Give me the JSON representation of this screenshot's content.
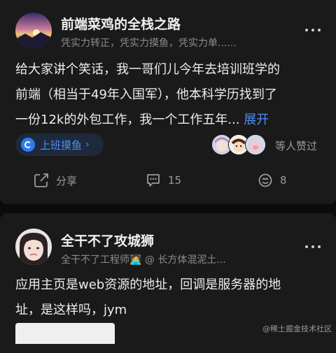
{
  "posts": [
    {
      "author": "前端菜鸡的全栈之路",
      "subtitle": "凭实力转正，凭实力摸鱼，凭实力单......",
      "content_line1": "给大家讲个笑话，我一哥们儿今年去培训班学的",
      "content_line2": "前端（相当于49年入国军），他本科学历找到了",
      "content_line3": "一份12k的外包工作，我一个工作五年...",
      "expand_label": "展开",
      "topic_label": "上班摸鱼",
      "topic_chevron": "›",
      "likes_text": "等人赞过",
      "actions": {
        "share_label": "分享",
        "comment_count": "15",
        "like_count": "8"
      }
    },
    {
      "author": "全干不了攻城狮",
      "subtitle": "全干不了工程师🧑‍💻 @ 长方体混泥土...",
      "content_line1": "应用主页是web资源的地址，回调是服务器的地",
      "content_line2": "址，是这样吗，jym"
    }
  ],
  "watermark": "@稀土掘金技术社区",
  "colors": {
    "background": "#0b0b0b",
    "card": "#1a1a1a",
    "accent": "#4e8ff4"
  }
}
